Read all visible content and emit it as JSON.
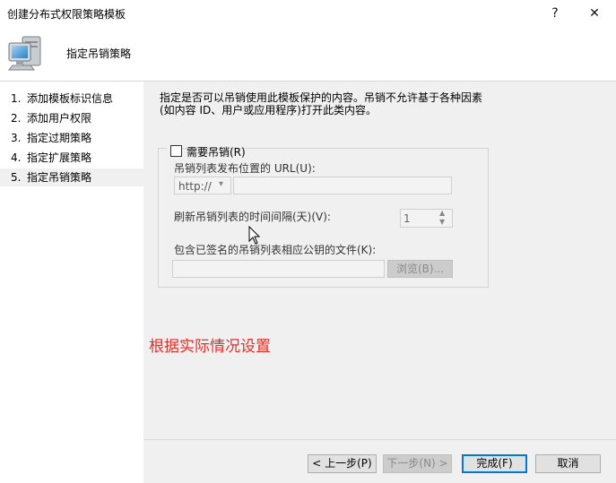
{
  "window": {
    "title": "创建分布式权限策略模板",
    "help_label": "?",
    "close_label": "✕"
  },
  "header": {
    "title": "指定吊销策略",
    "icon": "computer-icon"
  },
  "sidebar": {
    "items": [
      {
        "num": "1.",
        "label": "添加模板标识信息"
      },
      {
        "num": "2.",
        "label": "添加用户权限"
      },
      {
        "num": "3.",
        "label": "指定过期策略"
      },
      {
        "num": "4.",
        "label": "指定扩展策略"
      },
      {
        "num": "5.",
        "label": "指定吊销策略",
        "selected": true
      }
    ]
  },
  "main": {
    "description_line1": "指定是否可以吊销使用此模板保护的内容。吊销不允许基于各种因素",
    "description_line2": "(如内容 ID、用户或应用程序)打开此类内容。",
    "require_revocation_label": "需要吊销(R)",
    "require_revocation_checked": false,
    "url_label": "吊销列表发布位置的 URL(U):",
    "protocol_value": "http://",
    "url_value": "",
    "refresh_label": "刷新吊销列表的时间间隔(天)(V):",
    "refresh_value": "1",
    "file_label": "包含已签名的吊销列表相应公钥的文件(K):",
    "file_value": "",
    "browse_label": "浏览(B)..."
  },
  "annotation": "根据实际情况设置",
  "footer": {
    "prev_label": "< 上一步(P)",
    "next_label": "下一步(N) >",
    "finish_label": "完成(F)",
    "cancel_label": "取消"
  },
  "colors": {
    "annotation": "#e0302a",
    "accent": "#0078d7"
  }
}
